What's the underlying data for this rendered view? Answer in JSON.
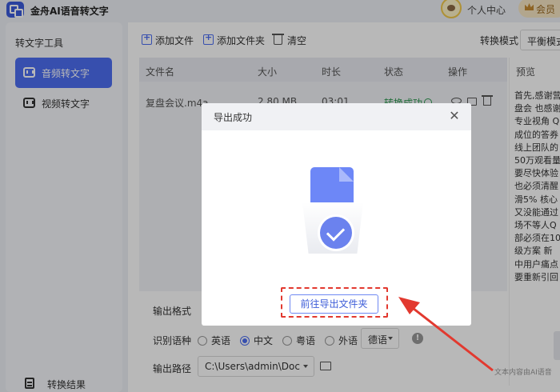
{
  "app": {
    "title": "金舟AI语音转文字"
  },
  "header": {
    "personal_center": "个人中心",
    "vip_label": "会员"
  },
  "sidebar": {
    "title": "转文字工具",
    "items": [
      {
        "label": "音频转文字",
        "active": true
      },
      {
        "label": "视频转文字",
        "active": false
      }
    ],
    "result_label": "转换结果"
  },
  "toolbar": {
    "add_file": "添加文件",
    "add_folder": "添加文件夹",
    "clear": "清空",
    "mode_label": "转换模式",
    "mode_value": "平衡模式"
  },
  "table": {
    "columns": [
      "文件名",
      "大小",
      "时长",
      "状态",
      "操作"
    ],
    "rows": [
      {
        "name": "复盘会议.m4a",
        "size": "2.80 MB",
        "duration": "03:01",
        "status": "转换成功"
      }
    ]
  },
  "preview": {
    "title": "预览",
    "lines": [
      "首先,感谢营",
      "盘会 也感谢",
      "专业视角 Q",
      "成位的答券",
      "线上团队的",
      "50万观看量",
      "要尽快体验",
      "也必须清醒",
      "滑5% 核心",
      "又没能通过",
      "场不等人Q",
      "部必须在10",
      "级方案 新",
      "中用户痛点",
      "要重新引回"
    ],
    "footer": "文本内容由AI语音"
  },
  "settings": {
    "output_format_label": "输出格式",
    "language_label": "识别语种",
    "language_options": [
      "英语",
      "中文",
      "粤语",
      "外语"
    ],
    "selected_language": "中文",
    "foreign_language_value": "德语",
    "output_path_label": "输出路径",
    "output_path_value": "C:\\Users\\admin\\Doc"
  },
  "modal": {
    "title": "导出成功",
    "button_label": "前往导出文件夹"
  },
  "colors": {
    "accent": "#4d6ef2",
    "success": "#2f9a52",
    "highlight": "#e2392f"
  }
}
